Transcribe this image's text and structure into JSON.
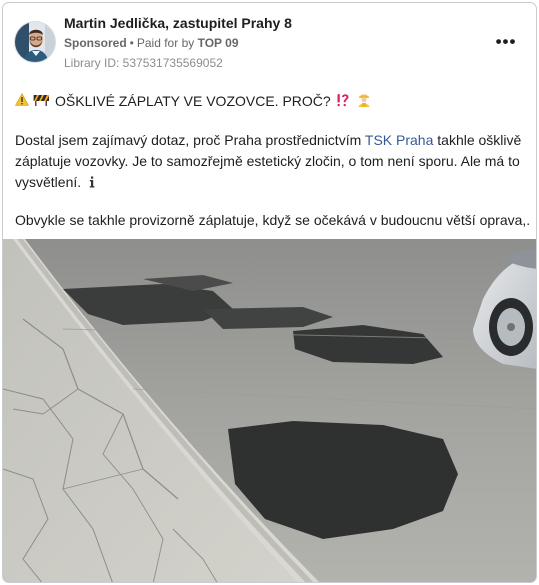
{
  "post": {
    "author": "Martin Jedlička, zastupitel Prahy 8",
    "sponsored": "Sponsored",
    "paid_for_prefix": "Paid for by",
    "payer": "TOP 09",
    "library_id": "Library ID: 537531735569052",
    "more_label": "•••",
    "headline_icons": [
      "warning-icon",
      "roadwork-barrier-icon"
    ],
    "headline": "OŠKLIVÉ ZÁPLATY VE VOZOVCE. PROČ?",
    "headline_trail_icons": [
      "exclamation-question-icon",
      "construction-worker-icon"
    ],
    "body_before_link": "Dostal jsem zajímavý dotaz, proč Praha prostřednictvím ",
    "body_link": "TSK Praha",
    "body_after_link": " takhle ošklivě záplatuje vozovky. Je to samozřejmě estetický zločin, o tom není sporu. Ale má to vysvětlení.",
    "body_info_icon": "information-icon",
    "body_second": "Obvykle se takhle provizorně záplatuje, když se očekává v budoucnu větší oprava,..."
  },
  "colors": {
    "link": "#385898",
    "text": "#1c1e21",
    "muted": "#65676b",
    "border": "#c8ccd1"
  }
}
